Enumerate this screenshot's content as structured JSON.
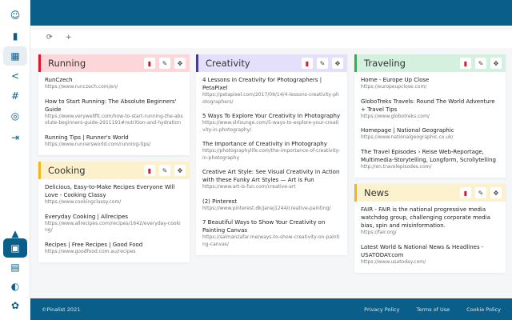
{
  "sidebar": {
    "items": [
      {
        "name": "avatar",
        "icon": "☺"
      },
      {
        "name": "bookmarks-icon",
        "icon": "▮"
      },
      {
        "name": "dashboard-icon",
        "icon": "▦"
      },
      {
        "name": "share-icon",
        "icon": "<"
      },
      {
        "name": "hashtag-icon",
        "icon": "#"
      },
      {
        "name": "database-icon",
        "icon": "◎"
      },
      {
        "name": "logout-icon",
        "icon": "⇥"
      },
      {
        "name": "graduation-icon",
        "icon": "▲"
      },
      {
        "name": "contact-book-icon",
        "icon": "▣"
      },
      {
        "name": "document-icon",
        "icon": "▤"
      },
      {
        "name": "shield-icon",
        "icon": "◐"
      },
      {
        "name": "cookie-icon",
        "icon": "✿"
      }
    ]
  },
  "toolbar": {
    "refresh": "⟳",
    "add": "+"
  },
  "icons": {
    "delete": "▮",
    "edit": "✎",
    "move": "✥"
  },
  "columns": [
    [
      {
        "title": "Running",
        "color": "#e0132b",
        "bg": "#fcd6d8",
        "links": [
          {
            "title": "RunCzech",
            "url": "https://www.runczech.com/en/"
          },
          {
            "title": "How to Start Running: The Absolute Beginners' Guide",
            "url": "https://www.verywellfit.com/how-to-start-running-the-absolute-beginners-guide-2911191#nutrition-and-hydration"
          },
          {
            "title": "Running Tips | Runner's World",
            "url": "https://www.runnersworld.com/running-tips/"
          }
        ]
      },
      {
        "title": "Cooking",
        "color": "#f2b61c",
        "bg": "#fcf1cd",
        "links": [
          {
            "title": "Delicious, Easy-to-Make Recipes Everyone Will Love - Cooking Classy",
            "url": "https://www.cookingclassy.com/"
          },
          {
            "title": "Everyday Cooking | Allrecipes",
            "url": "https://www.allrecipes.com/recipes/1642/everyday-cooking/"
          },
          {
            "title": "Recipes | Free Recipes | Good Food",
            "url": "https://www.goodfood.com.au/recipes"
          }
        ]
      }
    ],
    [
      {
        "title": "Creativity",
        "color": "#4b2fc9",
        "bg": "#e4e0fb",
        "links": [
          {
            "title": "4 Lessons in Creativity for Photographers | PetaPixel",
            "url": "https://petapixel.com/2017/09/14/4-lessons-creativity-photographers/"
          },
          {
            "title": "5 Ways To Explore Your Creativity In Photography",
            "url": "https://www.slrlounge.com/5-ways-to-explore-your-creativity-in-photography/"
          },
          {
            "title": "The Importance of Creativity in Photography",
            "url": "https://photographylife.com/the-importance-of-creativity-in-photography"
          },
          {
            "title": "Creative Art Style: See Visual Creativity in Action with these Funky Art Styles — Art is Fun",
            "url": "https://www.art-is-fun.com/creative-art"
          },
          {
            "title": "(2) Pinterest",
            "url": "https://www.pinterest.dk/janej1244/creative-painting/"
          },
          {
            "title": "7 Beautiful Ways to Show Your Creativity on Painting Canvas",
            "url": "https://salmanzafar.me/ways-to-show-creativity-on-painting-canvas/"
          }
        ]
      }
    ],
    [
      {
        "title": "Traveling",
        "color": "#2bb24c",
        "bg": "#d3f1de",
        "links": [
          {
            "title": "Home - Europe Up Close",
            "url": "https://europeupclose.com/"
          },
          {
            "title": "GloboTreks Travels: Round The World Adventure + Travel Tips",
            "url": "https://www.globotreks.com/"
          },
          {
            "title": "Homepage | National Geographic",
            "url": "https://www.nationalgeographic.co.uk/"
          },
          {
            "title": "The Travel Episodes › Reise Web-Reportage, Multimedia-Storytelling, Longform, Scrollytelling",
            "url": "http://en.travelepisodes.com/"
          }
        ]
      },
      {
        "title": "News",
        "color": "#f2b61c",
        "bg": "#fcf1cd",
        "links": [
          {
            "title": "FAIR - FAIR is the national progressive media watchdog group, challenging corporate media bias, spin and misinformation.",
            "url": "https://fair.org/"
          },
          {
            "title": "Latest World & National News & Headlines - USATODAY.com",
            "url": "https://www.usatoday.com/"
          }
        ]
      }
    ]
  ],
  "footer": {
    "copyright": "©Pinalist 2021",
    "links": [
      "Privacy Policy",
      "Terms of Use",
      "Cookie Policy"
    ]
  }
}
